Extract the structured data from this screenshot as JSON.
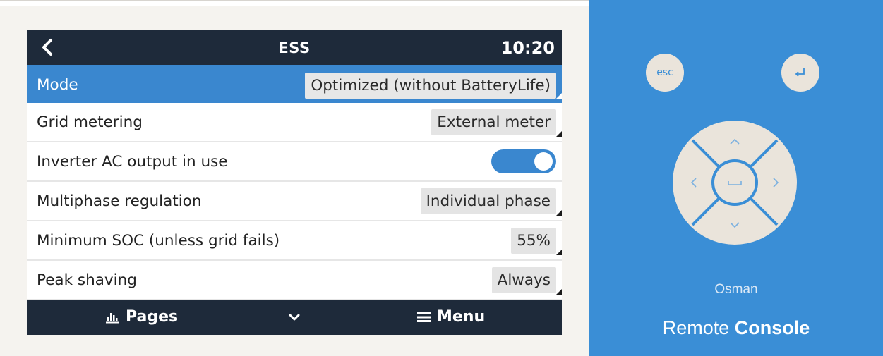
{
  "screen": {
    "title": "ESS",
    "clock": "10:20"
  },
  "settings": [
    {
      "label": "Mode",
      "value": "Optimized (without BatteryLife)",
      "selected": true
    },
    {
      "label": "Grid metering",
      "value": "External meter"
    },
    {
      "label": "Inverter AC output in use",
      "toggle_on": true
    },
    {
      "label": "Multiphase regulation",
      "value": "Individual phase"
    },
    {
      "label": "Minimum SOC (unless grid fails)",
      "value": "55%"
    },
    {
      "label": "Peak shaving",
      "value": "Always"
    }
  ],
  "bottombar": {
    "pages_label": "Pages",
    "menu_label": "Menu"
  },
  "remote": {
    "esc_label": "esc",
    "user": "Osman",
    "title_light": "Remote",
    "title_bold": "Console"
  },
  "icons": {
    "back": "chevron-left-icon",
    "pages": "bar-chart-icon",
    "down": "chevron-down-icon",
    "menu": "hamburger-icon",
    "enter": "enter-return-icon",
    "dpad_up": "chevron-up-icon",
    "dpad_down": "chevron-down-icon",
    "dpad_left": "chevron-left-icon",
    "dpad_right": "chevron-right-icon",
    "dpad_center": "space-bar-icon"
  },
  "colors": {
    "bar_dark": "#1e2a3a",
    "accent_blue": "#3a87cf",
    "panel_blue": "#3a8ed6",
    "button_cream": "#eae4db"
  }
}
